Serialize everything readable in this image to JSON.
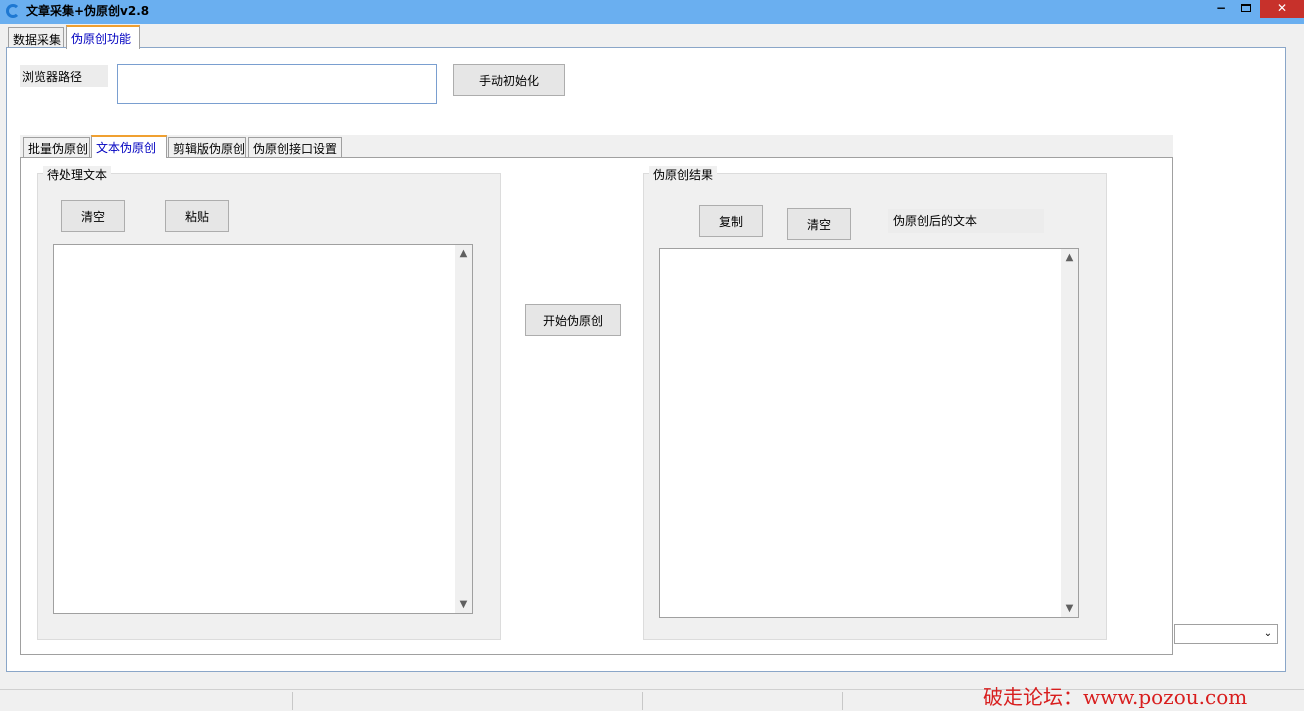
{
  "window": {
    "title": "文章采集+伪原创v2.8",
    "minimize_glyph": "−",
    "close_glyph": "✕"
  },
  "main_tabs": [
    {
      "label": "数据采集",
      "active": false
    },
    {
      "label": "伪原创功能",
      "active": true
    }
  ],
  "browser_path": {
    "label": "浏览器路径",
    "value": "",
    "init_button": "手动初始化"
  },
  "inner_tabs": [
    {
      "label": "批量伪原创",
      "active": false
    },
    {
      "label": "文本伪原创",
      "active": true
    },
    {
      "label": "剪辑版伪原创",
      "active": false
    },
    {
      "label": "伪原创接口设置",
      "active": false
    }
  ],
  "input_group": {
    "title": "待处理文本",
    "clear_button": "清空",
    "paste_button": "粘贴",
    "text": ""
  },
  "start_button": "开始伪原创",
  "result_group": {
    "title": "伪原创结果",
    "copy_button": "复制",
    "clear_button": "清空",
    "label": "伪原创后的文本",
    "text": ""
  },
  "scroll_icons": {
    "up": "▲",
    "down": "▼"
  },
  "combo_icon": "⌄",
  "watermark": "破走论坛：www.pozou.com",
  "colors": {
    "titlebar": "#6aaff0",
    "close_button": "#c7312b",
    "active_tab_text": "#0000c0",
    "watermark": "#d81e1e"
  }
}
